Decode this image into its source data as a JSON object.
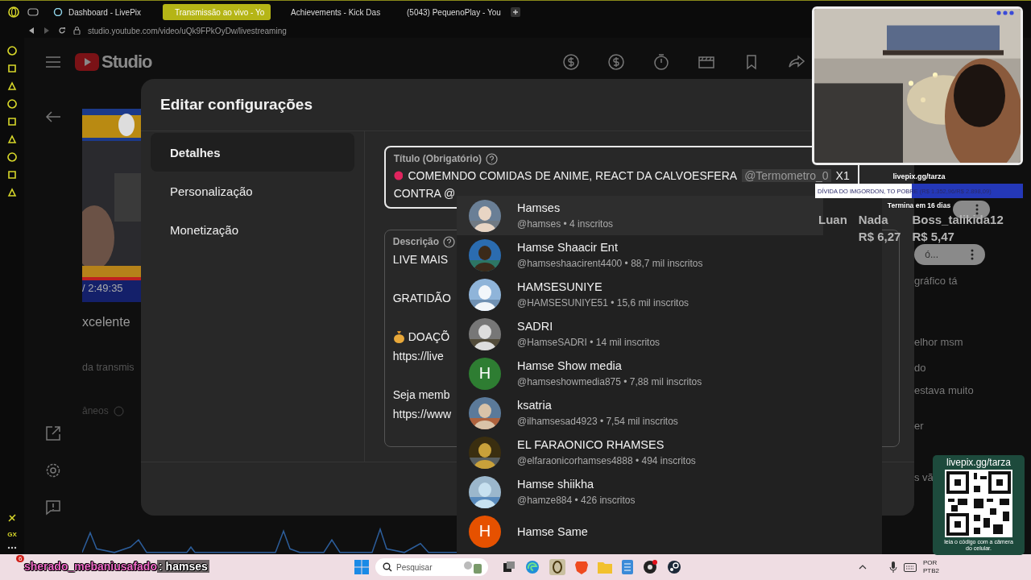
{
  "browser": {
    "tabs": [
      {
        "title": "Dashboard - LivePix",
        "selected": false,
        "kind": "livepix"
      },
      {
        "title": "Transmissão ao vivo - Yo",
        "selected": true,
        "kind": "youtube"
      },
      {
        "title": "Achievements - Kick Das",
        "selected": false,
        "kind": "kick"
      },
      {
        "title": "(5043) PequenoPlay - You",
        "selected": false,
        "kind": "youtube"
      }
    ],
    "address": "studio.youtube.com/video/uQk9FPkOyDw/livestreaming"
  },
  "opera_sidebar": {
    "label": "GX"
  },
  "studio": {
    "logo": "Studio"
  },
  "background_page": {
    "duration": "/ 2:49:35",
    "texts": [
      "xcelente",
      "da transmis",
      "âneos"
    ]
  },
  "dialog": {
    "title": "Editar configurações",
    "nav": [
      {
        "label": "Detalhes",
        "selected": true
      },
      {
        "label": "Personalização",
        "selected": false
      },
      {
        "label": "Monetização",
        "selected": false
      }
    ],
    "title_field": {
      "label": "Título (Obrigatório)",
      "text": "COMEMNDO COMIDAS DE ANIME, REACT DA CALVOESFERA",
      "mention": "@Termometro_0",
      "after_mention": "X1",
      "line2": "CONTRA @"
    },
    "description_field": {
      "label": "Descrição",
      "paragraphs": [
        [
          {
            "text": "LIVE MAIS",
            "kind": "text"
          }
        ],
        [
          {
            "text": "GRATIDÃO",
            "kind": "text"
          }
        ],
        [
          {
            "text": "DOAÇÕ",
            "kind": "money"
          },
          {
            "text": "https://live",
            "kind": "text"
          }
        ],
        [
          {
            "text": "Seja memb",
            "kind": "text"
          },
          {
            "text": "https://www",
            "kind": "text"
          }
        ]
      ]
    }
  },
  "mention_suggestions": [
    {
      "name": "Hamses",
      "handle": "@hamses • 4 inscritos",
      "selected": true
    },
    {
      "name": "Hamse Shaacir Ent",
      "handle": "@hamseshaacirent4400 • 88,7 mil inscritos",
      "selected": false
    },
    {
      "name": "HAMSESUNIYE",
      "handle": "@HAMSESUNIYE51 • 15,6 mil inscritos",
      "selected": false
    },
    {
      "name": "SADRI",
      "handle": "@HamseSADRI • 14 mil inscritos",
      "selected": false
    },
    {
      "name": "Hamse Show media",
      "handle": "@hamseshowmedia875 • 7,88 mil inscritos",
      "selected": false,
      "avatar": {
        "kind": "letter",
        "letter": "H",
        "color": "#2e7d32"
      }
    },
    {
      "name": "ksatria",
      "handle": "@ilhamsesad4923 • 7,54 mil inscritos",
      "selected": false
    },
    {
      "name": "EL FARAONICO RHAMSES",
      "handle": "@elfaraonicorhamses4888 • 494 inscritos",
      "selected": false
    },
    {
      "name": "Hamse shiikha",
      "handle": "@hamze884 • 426 inscritos",
      "selected": false
    },
    {
      "name": "Hamse Same",
      "selected": false,
      "avatar": {
        "kind": "letter",
        "letter": "H",
        "color": "#e65100"
      }
    }
  ],
  "chat_panel": {
    "chip_text": "ó...",
    "fragments": [
      "gráfico tá",
      "elhor msm",
      "do",
      "estava muito",
      "er",
      "s vã"
    ]
  },
  "stream_overlay": {
    "goal": {
      "site": "livepix.gg/tarza",
      "text": "DÍVIDA DO IMGORDON, TO POBRE (R$ 1.352,96/R$ 2.898,09)",
      "level": 0.467,
      "ends": "Termina em 16 dias"
    },
    "donors": [
      {
        "name": "Luan"
      },
      {
        "name": "Nada",
        "amount": "R$ 6,27"
      },
      {
        "name": "Boss_talikida12",
        "amount": "R$ 5,47"
      }
    ],
    "qr": {
      "site": "livepix.gg/tarza",
      "caption": "leia o código com a câmera do celular."
    },
    "chat_message": {
      "user": "sherado_mebaniusafado",
      "separator": ":",
      "message": "hamses"
    }
  },
  "taskbar": {
    "weather_badge": "6",
    "search_placeholder": "Pesquisar",
    "language": "POR",
    "layout": "PTB2"
  }
}
